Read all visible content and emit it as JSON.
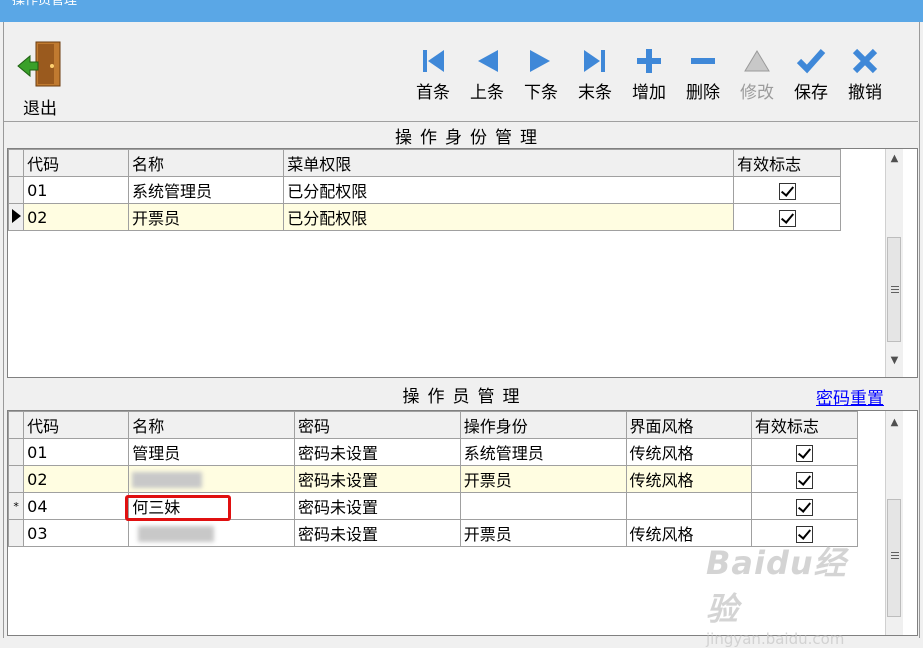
{
  "window": {
    "title": "操作员管理"
  },
  "toolbar": {
    "exit_label": "退出",
    "buttons": [
      {
        "label": "首条",
        "icon": "first-icon",
        "enabled": true
      },
      {
        "label": "上条",
        "icon": "prev-icon",
        "enabled": true
      },
      {
        "label": "下条",
        "icon": "next-icon",
        "enabled": true
      },
      {
        "label": "末条",
        "icon": "last-icon",
        "enabled": true
      },
      {
        "label": "增加",
        "icon": "plus-icon",
        "enabled": true
      },
      {
        "label": "删除",
        "icon": "minus-icon",
        "enabled": true
      },
      {
        "label": "修改",
        "icon": "triangle-icon",
        "enabled": false
      },
      {
        "label": "保存",
        "icon": "check-icon",
        "enabled": true
      },
      {
        "label": "撤销",
        "icon": "x-icon",
        "enabled": true
      }
    ],
    "accent": "#3f88d8"
  },
  "roles": {
    "title": "操作身份管理",
    "columns": [
      "代码",
      "名称",
      "菜单权限",
      "有效标志"
    ],
    "rows": [
      {
        "code": "01",
        "name": "系统管理员",
        "perm": "已分配权限",
        "valid": true,
        "current": false
      },
      {
        "code": "02",
        "name": "开票员",
        "perm": "已分配权限",
        "valid": true,
        "current": true
      }
    ]
  },
  "operators": {
    "title": "操作员管理",
    "reset_link": "密码重置",
    "columns": [
      "代码",
      "名称",
      "密码",
      "操作身份",
      "界面风格",
      "有效标志"
    ],
    "rows": [
      {
        "marker": "",
        "code": "01",
        "name": "管理员",
        "password": "密码未设置",
        "role": "系统管理员",
        "style": "传统风格",
        "valid": true
      },
      {
        "marker": "",
        "code": "02",
        "name": "",
        "password": "密码未设置",
        "role": "开票员",
        "style": "传统风格",
        "valid": true
      },
      {
        "marker": "*",
        "code": "04",
        "name": "何三妹",
        "password": "密码未设置",
        "role": "",
        "style": "",
        "valid": true
      },
      {
        "marker": "",
        "code": "03",
        "name": "",
        "password": "密码未设置",
        "role": "开票员",
        "style": "传统风格",
        "valid": true
      }
    ]
  },
  "watermark": {
    "brand": "Baidu经验",
    "url": "jingyan.baidu.com"
  }
}
